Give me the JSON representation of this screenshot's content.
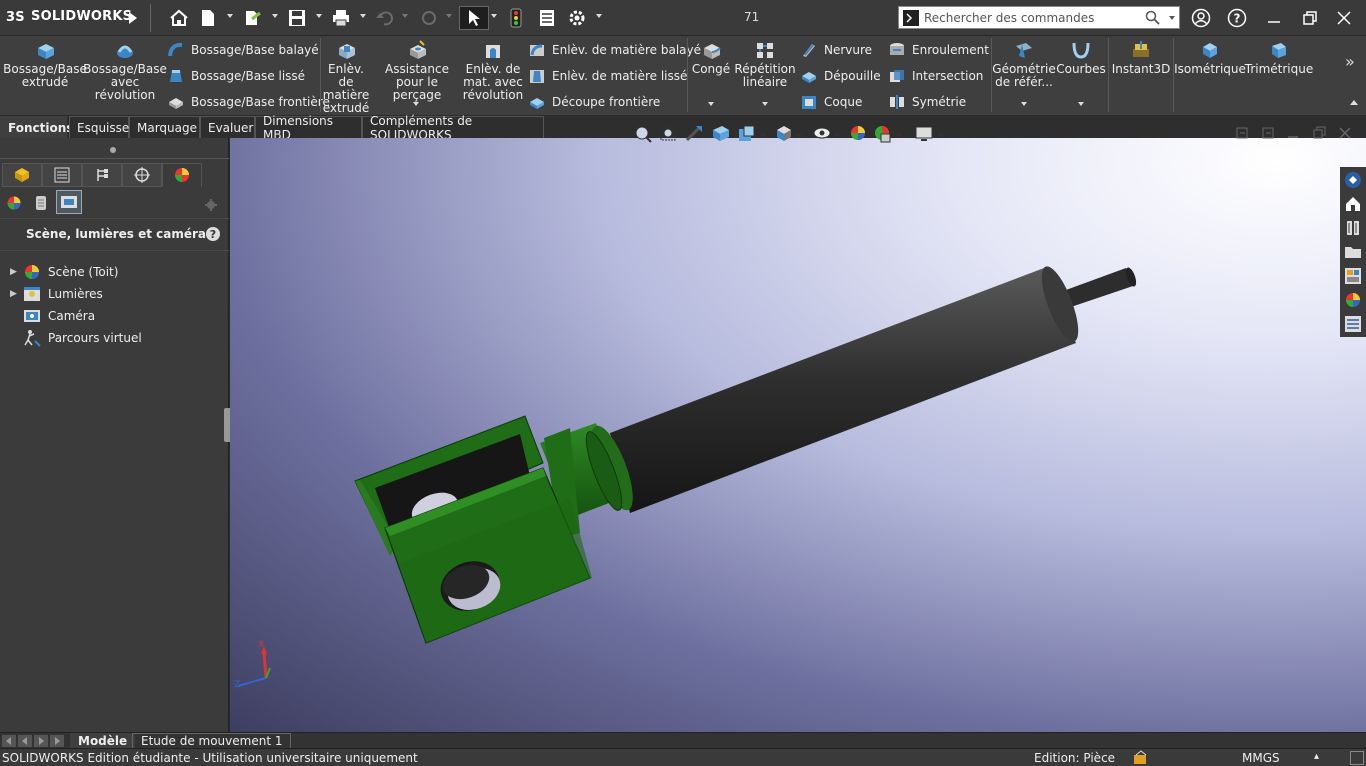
{
  "app": {
    "logo_text": "SOLIDWORKS",
    "center_number": "71",
    "search_placeholder": "Rechercher des commandes"
  },
  "toolbar_icons": [
    "home-icon",
    "new-file-icon",
    "open-icon",
    "save-icon",
    "print-icon",
    "undo-icon",
    "redo-icon",
    "select-arrow-icon",
    "traffic-light-icon",
    "file-properties-icon",
    "options-gear-icon"
  ],
  "ribbon": {
    "bossage_extrude": "Bossage/Base extrudé",
    "bossage_revolution": "Bossage/Base avec révolution",
    "bossage_balaye": "Bossage/Base balayé",
    "bossage_lisse": "Bossage/Base lissé",
    "bossage_frontiere": "Bossage/Base frontière",
    "enlev_extrude": "Enlèv. de matière extrudé",
    "assistance_percage": "Assistance pour le perçage",
    "enlev_revolution": "Enlèv. de mat. avec révolution",
    "enlev_balaye": "Enlèv. de matière balayé",
    "enlev_lisse": "Enlèv. de matière lissé",
    "decoupe_frontiere": "Découpe frontière",
    "conge": "Congé",
    "repetition": "Répétition linéaire",
    "nervure": "Nervure",
    "depouille": "Dépouille",
    "coque": "Coque",
    "enroulement": "Enroulement",
    "intersection": "Intersection",
    "symetrie": "Symétrie",
    "geometrie": "Géométrie de référ...",
    "courbes": "Courbes",
    "instant3d": "Instant3D",
    "isometrique": "Isométrique",
    "trimetrique": "Trimétrique",
    "more": "»"
  },
  "command_tabs": [
    "Fonctions",
    "Esquisse",
    "Marquage",
    "Evaluer",
    "Dimensions MBD",
    "Compléments de SOLIDWORKS"
  ],
  "panel": {
    "title": "Scène, lumières et caméras",
    "help": "?",
    "tree": [
      {
        "label": "Scène (Toit)",
        "expandable": true,
        "icon": "scene-icon"
      },
      {
        "label": "Lumières",
        "expandable": true,
        "icon": "lights-icon"
      },
      {
        "label": "Caméra",
        "expandable": false,
        "icon": "camera-icon"
      },
      {
        "label": "Parcours virtuel",
        "expandable": false,
        "icon": "walkthrough-icon"
      }
    ]
  },
  "triad": {
    "x_label": "X",
    "z_label": "Z"
  },
  "bottom_tabs": [
    "Modèle",
    "Etude de mouvement 1"
  ],
  "status": {
    "left": "SOLIDWORKS Edition étudiante - Utilisation universitaire uniquement",
    "mode": "Edition: Pièce",
    "units": "MMGS",
    "units_caret": "▴"
  },
  "colors": {
    "part_green": "#1f6d16",
    "shaft_black": "#2b2b2b",
    "ui_dark": "#3b3b3b"
  }
}
